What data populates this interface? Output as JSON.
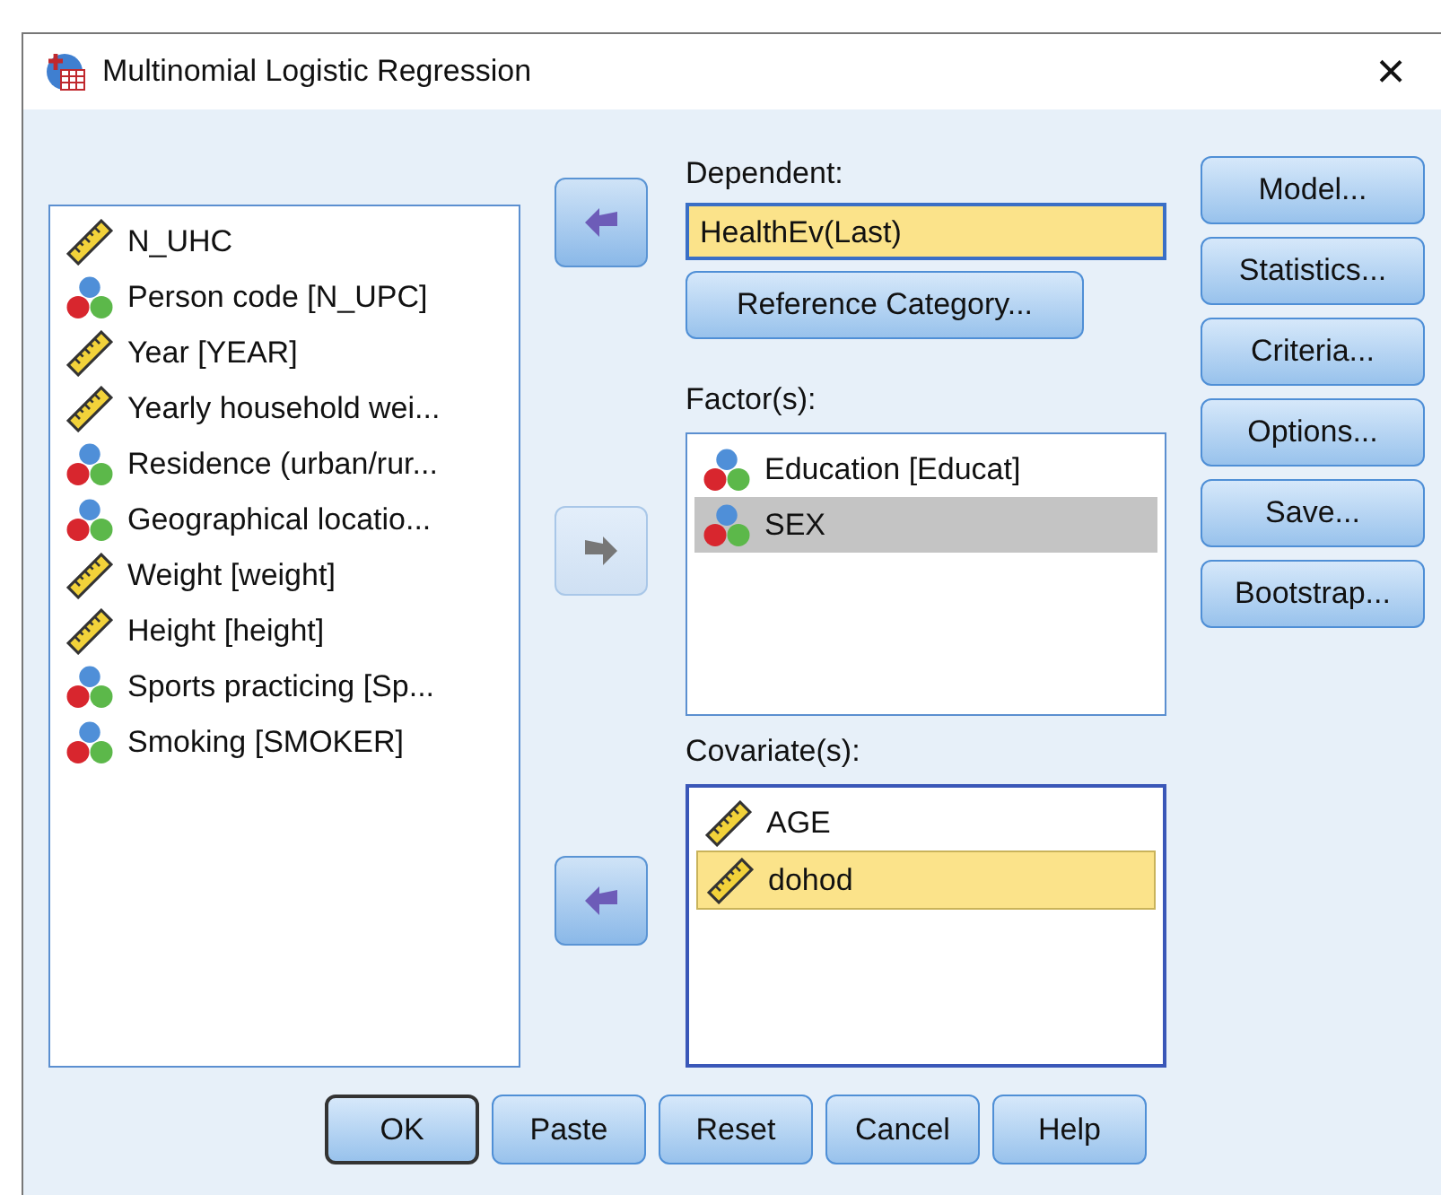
{
  "window": {
    "title": "Multinomial Logistic Regression",
    "close": "×"
  },
  "source_list": {
    "focused": false,
    "items": [
      {
        "name": "N_UHC",
        "kind": "scale",
        "selected": false
      },
      {
        "name": "Person code [N_UPC]",
        "kind": "nominal",
        "selected": false
      },
      {
        "name": "Year [YEAR]",
        "kind": "scale",
        "selected": false
      },
      {
        "name": "Yearly household wei...",
        "kind": "scale",
        "selected": false
      },
      {
        "name": "Residence (urban/rur...",
        "kind": "nominal",
        "selected": false
      },
      {
        "name": "Geographical locatio...",
        "kind": "nominal",
        "selected": false
      },
      {
        "name": "Weight [weight]",
        "kind": "scale",
        "selected": false
      },
      {
        "name": "Height [height]",
        "kind": "scale",
        "selected": false
      },
      {
        "name": "Sports practicing [Sp...",
        "kind": "nominal",
        "selected": false
      },
      {
        "name": "Smoking [SMOKER]",
        "kind": "nominal",
        "selected": false
      }
    ]
  },
  "dependent": {
    "label": "Dependent:",
    "value": "HealthEv(Last)",
    "arrow": {
      "kind": "left",
      "disabled": false
    }
  },
  "reference_button": {
    "label": "Reference Category..."
  },
  "factors": {
    "label": "Factor(s):",
    "focused": false,
    "arrow": {
      "kind": "right",
      "disabled": true
    },
    "items": [
      {
        "name": "Education [Educat]",
        "kind": "nominal",
        "selected": false
      },
      {
        "name": "SEX",
        "kind": "nominal",
        "selected": true
      }
    ]
  },
  "covariates": {
    "label": "Covariate(s):",
    "focused": true,
    "arrow": {
      "kind": "left",
      "disabled": false
    },
    "items": [
      {
        "name": "AGE",
        "kind": "scale",
        "selected": false
      },
      {
        "name": "dohod",
        "kind": "scale",
        "selected": true
      }
    ]
  },
  "side_buttons": [
    {
      "label": "Model..."
    },
    {
      "label": "Statistics..."
    },
    {
      "label": "Criteria..."
    },
    {
      "label": "Options..."
    },
    {
      "label": "Save..."
    },
    {
      "label": "Bootstrap..."
    }
  ],
  "bottom_buttons": [
    {
      "label": "OK",
      "default": true
    },
    {
      "label": "Paste",
      "default": false
    },
    {
      "label": "Reset",
      "default": false
    },
    {
      "label": "Cancel",
      "default": false
    },
    {
      "label": "Help",
      "default": false
    }
  ]
}
